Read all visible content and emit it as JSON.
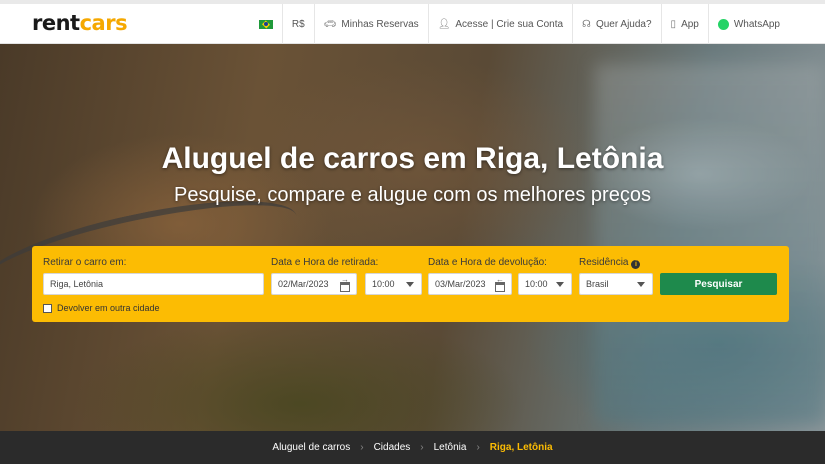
{
  "header": {
    "logo_rent": "rent",
    "logo_cars": "cars",
    "nav": {
      "currency": "R$",
      "reservations": "Minhas Reservas",
      "account": "Acesse | Crie sua Conta",
      "help": "Quer Ajuda?",
      "app": "App",
      "whatsapp": "WhatsApp"
    },
    "icons": [
      "brazil-flag-icon",
      "car-icon",
      "user-icon",
      "headset-icon",
      "phone-icon",
      "whatsapp-icon"
    ]
  },
  "hero": {
    "title": "Aluguel de carros em Riga, Letônia",
    "subtitle": "Pesquise, compare e alugue com os melhores preços"
  },
  "search": {
    "pickup_label": "Retirar o carro em:",
    "pickup_value": "Riga, Letônia",
    "pickup_date_label": "Data e Hora de retirada:",
    "pickup_date": "02/Mar/2023",
    "pickup_time": "10:00",
    "return_date_label": "Data e Hora de devolução:",
    "return_date": "03/Mar/2023",
    "return_time": "10:00",
    "residence_label": "Residência",
    "residence_value": "Brasil",
    "search_button": "Pesquisar",
    "other_city_label": "Devolver em outra cidade",
    "info_symbol": "i"
  },
  "breadcrumb": {
    "items": [
      "Aluguel de carros",
      "Cidades",
      "Letônia"
    ],
    "current": "Riga, Letônia",
    "separator": "›"
  },
  "colors": {
    "accent": "#fcbc03",
    "button": "#1e8a4c",
    "breadcrumb_bg": "#2b2b2b"
  }
}
